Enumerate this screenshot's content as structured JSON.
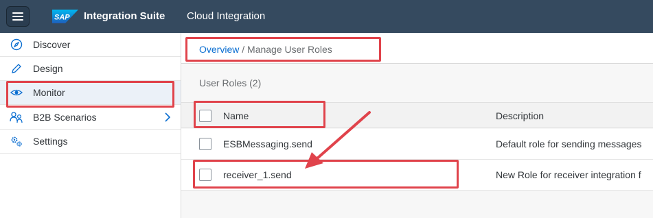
{
  "header": {
    "logo_text": "SAP",
    "product": "Integration Suite",
    "subtitle": "Cloud Integration"
  },
  "sidebar": {
    "items": [
      {
        "label": "Discover",
        "icon": "compass-icon"
      },
      {
        "label": "Design",
        "icon": "pencil-icon"
      },
      {
        "label": "Monitor",
        "icon": "eye-icon",
        "selected": true
      },
      {
        "label": "B2B Scenarios",
        "icon": "b2b-users-icon",
        "has_children": true
      },
      {
        "label": "Settings",
        "icon": "gears-icon"
      }
    ]
  },
  "breadcrumb": {
    "link": "Overview",
    "separator": " / ",
    "current": "Manage User Roles"
  },
  "table": {
    "title": "User Roles (2)",
    "columns": [
      "Name",
      "Description"
    ],
    "rows": [
      {
        "name": "ESBMessaging.send",
        "description": "Default role for sending messages"
      },
      {
        "name": "receiver_1.send",
        "description": "New Role for receiver integration f"
      }
    ]
  },
  "colors": {
    "shell": "#354a5f",
    "link": "#0a6ed1",
    "annotation": "#e0434b"
  }
}
